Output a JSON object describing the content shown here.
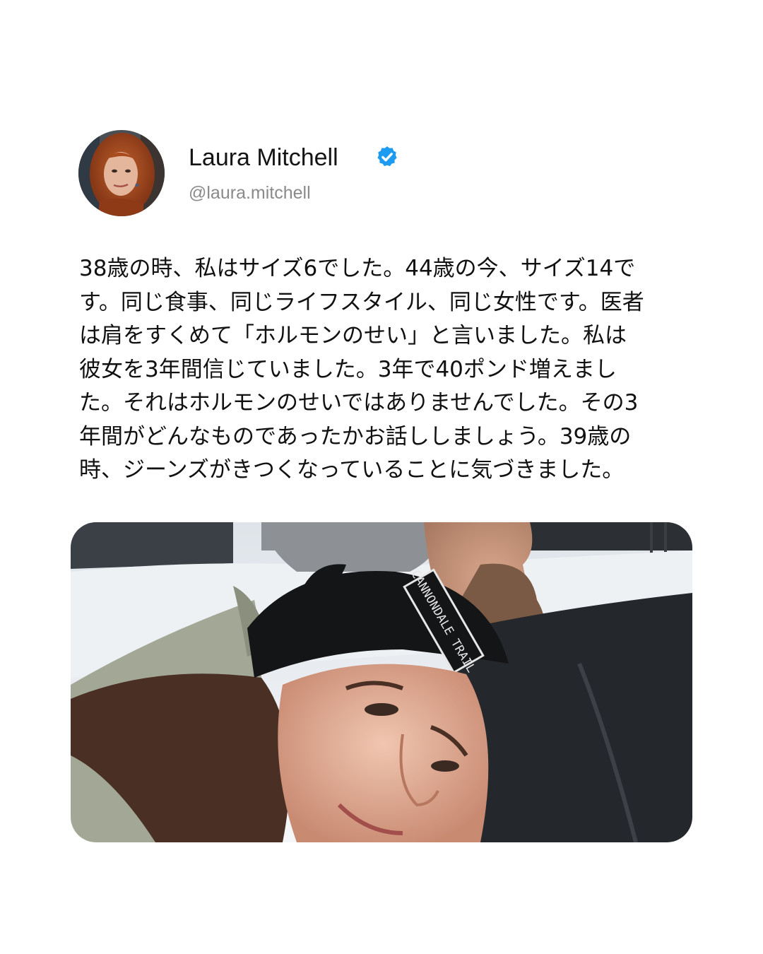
{
  "author": {
    "display_name": "Laura Mitchell",
    "handle": "@laura.mitchell",
    "avatar_icon": "profile-photo-avatar",
    "verified_icon": "verified-badge-icon",
    "verified_color": "#1d9bf0"
  },
  "post": {
    "text_lines": [
      "38歳の時、私はサイズ6でした。44歳の今、サイズ14で",
      "す。同じ食事、同じライフスタイル、同じ女性です。医者",
      "は肩をすくめて「ホルモンのせい」と言いました。私は",
      "彼女を3年間信じていました。3年で40ポンド増えまし",
      "た。それはホルモンのせいではありませんでした。その3",
      "年間がどんなものであったかお話ししましょう。39歳の",
      "時、ジーンズがきつくなっていることに気づきました。"
    ]
  },
  "media": {
    "beanie_lettering": "CANNONDALE TRAIL"
  }
}
